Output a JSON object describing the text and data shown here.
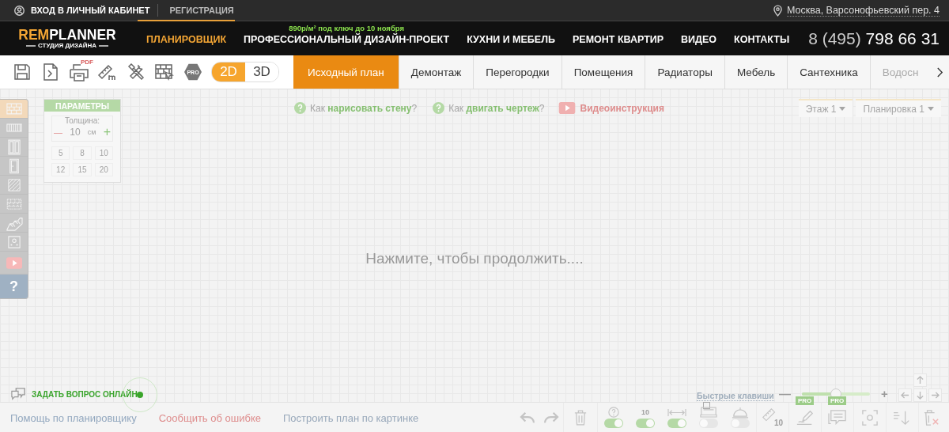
{
  "topbar": {
    "login": "ВХОД В ЛИЧНЫЙ КАБИНЕТ",
    "register": "РЕГИСТРАЦИЯ",
    "address": "Москва, Варсонофьевский пер. 4"
  },
  "header": {
    "logo": {
      "accent": "REM",
      "rest": "PLANNER",
      "tagline": "СТУДИЯ ДИЗАЙНА"
    },
    "nav": [
      {
        "label": "ПЛАНИРОВЩИК",
        "selected": true
      },
      {
        "label": "ПРОФЕССИОНАЛЬНЫЙ ДИЗАЙН-ПРОЕКТ",
        "selected": false,
        "promo": "890р/м² под ключ до 10 ноября"
      },
      {
        "label": "КУХНИ И МЕБЕЛЬ",
        "selected": false
      },
      {
        "label": "РЕМОНТ КВАРТИР",
        "selected": false
      },
      {
        "label": "ВИДЕО",
        "selected": false
      },
      {
        "label": "КОНТАКТЫ",
        "selected": false
      }
    ],
    "phone": {
      "code": "8 (495)",
      "number": "798 66 31"
    }
  },
  "toolbar": {
    "pdf_label": "PDF",
    "pro_label": "PRO",
    "view_modes": [
      {
        "label": "2D",
        "selected": true
      },
      {
        "label": "3D",
        "selected": false
      }
    ],
    "tabs": [
      {
        "label": "Исходный план",
        "selected": true
      },
      {
        "label": "Демонтаж",
        "selected": false
      },
      {
        "label": "Перегородки",
        "selected": false
      },
      {
        "label": "Помещения",
        "selected": false
      },
      {
        "label": "Радиаторы",
        "selected": false
      },
      {
        "label": "Мебель",
        "selected": false
      },
      {
        "label": "Сантехника",
        "selected": false
      },
      {
        "label": "Водосн",
        "selected": false
      }
    ]
  },
  "canvas": {
    "tools": [
      {
        "kind": "brick",
        "selected": true
      },
      {
        "kind": "radiator",
        "selected": false
      },
      {
        "kind": "window",
        "selected": false
      },
      {
        "kind": "door",
        "selected": false
      },
      {
        "kind": "hatch",
        "selected": false
      },
      {
        "kind": "blocks",
        "selected": false
      },
      {
        "kind": "stairs",
        "selected": false
      },
      {
        "kind": "socket",
        "selected": false
      },
      {
        "kind": "video",
        "selected": false
      },
      {
        "kind": "help",
        "label": "?",
        "selected": false
      }
    ],
    "params": {
      "title": "ПАРАМЕТРЫ",
      "thickness_label": "Толщина:",
      "decrement": "—",
      "value": "10",
      "unit": "см",
      "increment": "+",
      "presets": [
        "5",
        "8",
        "10",
        "12",
        "15",
        "20"
      ]
    },
    "help_links": [
      {
        "kind": "help",
        "text": "Как **нарисовать стену**?"
      },
      {
        "kind": "help",
        "text": "Как **двигать чертеж**?"
      },
      {
        "kind": "video",
        "text": "Видеоинструкция"
      }
    ],
    "selectors": [
      {
        "label": "Этаж 1"
      },
      {
        "label": "Планировка 1"
      }
    ],
    "message": "Нажмите, чтобы продолжить....",
    "chat": {
      "label": "ЗАДАТЬ ВОПРОС ОНЛАЙН",
      "online": true
    },
    "hotkeys": {
      "label": "Быстрые клавиши",
      "checked": false
    },
    "zoom": {
      "minus": "—",
      "plus": "+",
      "level": 0.5
    }
  },
  "footer": {
    "links": [
      {
        "text": "Помощь по планировщику",
        "color": "#93a8bf"
      },
      {
        "text": "Сообщить об ошибке",
        "color": "#de8d8d"
      },
      {
        "text": "Построить план по картинке",
        "color": "#98a8ba"
      }
    ],
    "tools": [
      {
        "kind": "undo"
      },
      {
        "kind": "redo"
      },
      {
        "kind": "delete"
      },
      {
        "kind": "hint",
        "on": true
      },
      {
        "kind": "grid",
        "label": "10",
        "on": true
      },
      {
        "kind": "size",
        "on": true
      },
      {
        "kind": "furniture",
        "on": false
      },
      {
        "kind": "lamp",
        "on": false
      },
      {
        "kind": "ruler",
        "label": "10"
      },
      {
        "kind": "pen",
        "badge": "PRO"
      },
      {
        "kind": "comment",
        "badge": "PRO"
      },
      {
        "kind": "focus"
      },
      {
        "kind": "sort"
      },
      {
        "kind": "clear"
      }
    ]
  }
}
